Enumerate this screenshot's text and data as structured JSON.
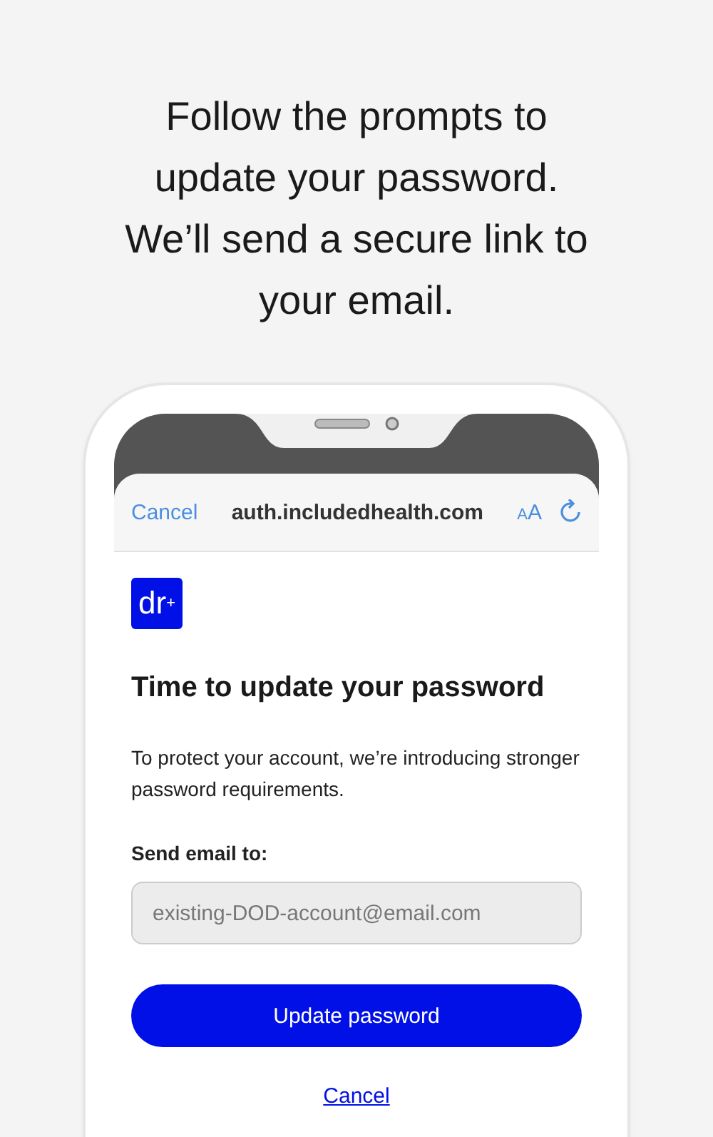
{
  "headline": "Follow the prompts to update your password. We’ll send a secure link to your email.",
  "browser_bar": {
    "cancel": "Cancel",
    "address": "auth.includedhealth.com",
    "text_size": "AA"
  },
  "logo": {
    "letters": "dr",
    "mark": "+"
  },
  "title": "Time to update your password",
  "description": "To protect your account, we’re introducing stronger password requirements.",
  "email_field": {
    "label": "Send email to:",
    "value": "existing-DOD-account@email.com",
    "disabled": true
  },
  "primary_button": "Update password",
  "cancel_link": "Cancel"
}
